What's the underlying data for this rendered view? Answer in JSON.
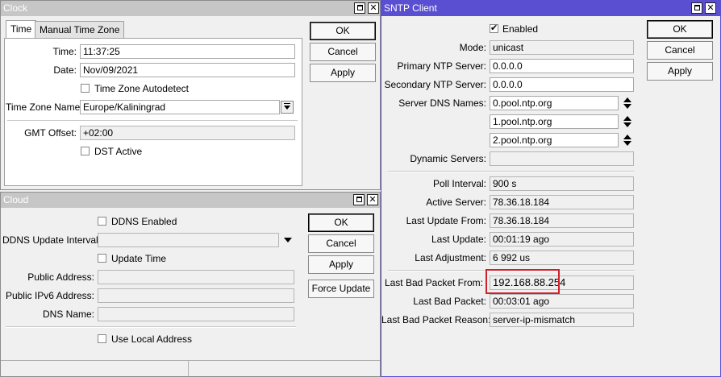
{
  "clock": {
    "title": "Clock",
    "tabs": [
      "Time",
      "Manual Time Zone"
    ],
    "time_label": "Time:",
    "time_value": "11:37:25",
    "date_label": "Date:",
    "date_value": "Nov/09/2021",
    "tz_autodetect_label": "Time Zone Autodetect",
    "tz_name_label": "Time Zone Name:",
    "tz_name_value": "Europe/Kaliningrad",
    "gmt_offset_label": "GMT Offset:",
    "gmt_offset_value": "+02:00",
    "dst_label": "DST Active",
    "buttons": {
      "ok": "OK",
      "cancel": "Cancel",
      "apply": "Apply"
    }
  },
  "cloud": {
    "title": "Cloud",
    "ddns_enabled_label": "DDNS Enabled",
    "ddns_interval_label": "DDNS Update Interval:",
    "ddns_interval_value": "",
    "update_time_label": "Update Time",
    "public_address_label": "Public Address:",
    "public_address_value": "",
    "public_ipv6_label": "Public IPv6 Address:",
    "public_ipv6_value": "",
    "dns_name_label": "DNS Name:",
    "dns_name_value": "",
    "use_local_label": "Use Local Address",
    "buttons": {
      "ok": "OK",
      "cancel": "Cancel",
      "apply": "Apply",
      "force_update": "Force Update"
    }
  },
  "sntp": {
    "title": "SNTP Client",
    "enabled_label": "Enabled",
    "mode_label": "Mode:",
    "mode_value": "unicast",
    "primary_label": "Primary NTP Server:",
    "primary_value": "0.0.0.0",
    "secondary_label": "Secondary NTP Server:",
    "secondary_value": "0.0.0.0",
    "dns_names_label": "Server DNS Names:",
    "dns_names": [
      "0.pool.ntp.org",
      "1.pool.ntp.org",
      "2.pool.ntp.org"
    ],
    "dynamic_label": "Dynamic Servers:",
    "dynamic_value": "",
    "poll_label": "Poll Interval:",
    "poll_value": "900 s",
    "active_label": "Active Server:",
    "active_value": "78.36.18.184",
    "last_update_from_label": "Last Update From:",
    "last_update_from_value": "78.36.18.184",
    "last_update_label": "Last Update:",
    "last_update_value": "00:01:19 ago",
    "last_adjust_label": "Last Adjustment:",
    "last_adjust_value": "6 992 us",
    "bad_from_label": "Last Bad Packet From:",
    "bad_from_value": "192.168.88.254",
    "bad_packet_label": "Last Bad Packet:",
    "bad_packet_value": "00:03:01 ago",
    "bad_reason_label": "Last Bad Packet Reason:",
    "bad_reason_value": "server-ip-mismatch",
    "buttons": {
      "ok": "OK",
      "cancel": "Cancel",
      "apply": "Apply"
    }
  },
  "colors": {
    "active_title": "#5a4fd1",
    "inactive_title": "#c6c6c6",
    "highlight": "#d0202a"
  }
}
